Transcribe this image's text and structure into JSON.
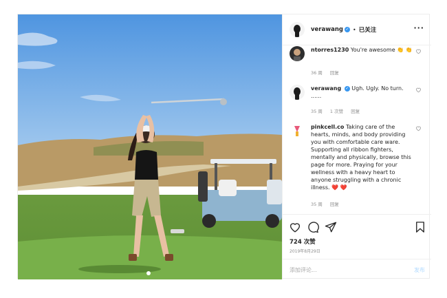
{
  "post": {
    "username": "verawang",
    "separator": "•",
    "follow_label": "已关注",
    "more_label": "···"
  },
  "comments": [
    {
      "username": "ntorres1230",
      "text": "You're awesome 👏 👏",
      "time": "36 周",
      "likes": "",
      "reply_label": "回复"
    },
    {
      "username": "verawang",
      "text": "Ugh. Ugly. No turn. ......",
      "time": "35 周",
      "likes": "1 次赞",
      "reply_label": "回复"
    },
    {
      "username": "pinkcell.co",
      "text": "Taking care of the hearts, minds, and body providing you with comfortable care ware. Supporting all ribbon fighters, mentally and physically, browse this page for more. Praying for your wellness with a heavy heart to anyone struggling with a chronic illness. ❤️ ❤️",
      "time": "35 周",
      "likes": "",
      "reply_label": "回复"
    }
  ],
  "stats": {
    "likes": "724 次赞",
    "date": "2019年8月29日"
  },
  "comment_box": {
    "placeholder": "添加评论...",
    "post_label": "发布"
  },
  "icons": [
    "like-icon",
    "comment-icon",
    "share-icon",
    "save-icon",
    "verified-icon",
    "more-icon"
  ],
  "colors": {
    "verified": "#3897f0",
    "post_disabled": "#b3dbff",
    "muted": "#8e8e8e"
  }
}
